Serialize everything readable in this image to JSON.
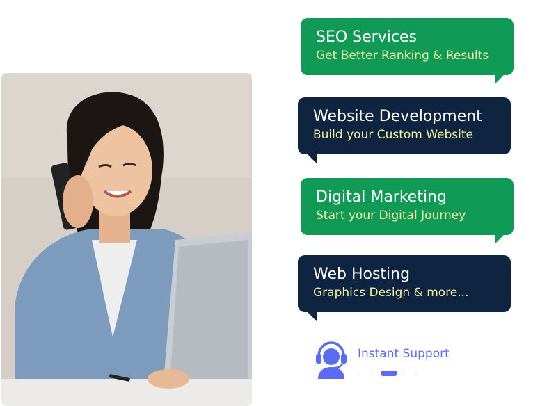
{
  "services": [
    {
      "title": "SEO Services",
      "subtitle": "Get Better Ranking & Results",
      "color": "#109a55"
    },
    {
      "title": "Website Development",
      "subtitle": "Build your Custom Website",
      "color": "#0f2440"
    },
    {
      "title": "Digital Marketing",
      "subtitle": "Start your Digital Journey",
      "color": "#109a55"
    },
    {
      "title": "Web Hosting",
      "subtitle": "Graphics Design & more...",
      "color": "#0f2440"
    }
  ],
  "support": {
    "label": "Instant Support",
    "icon": "headset-agent-icon",
    "accent": "#5b6cf0"
  },
  "photo": {
    "icon": "woman-on-phone-photo"
  },
  "pagination": {
    "active_index": 1
  }
}
